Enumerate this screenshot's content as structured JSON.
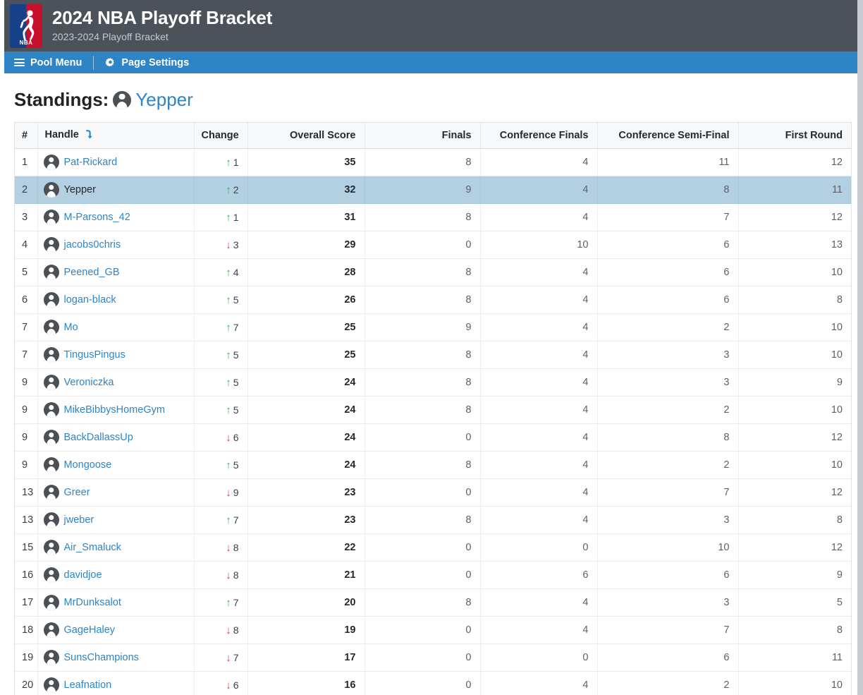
{
  "header": {
    "logo_icon": "nba-logo",
    "logo_word": "NBA",
    "title": "2024 NBA Playoff Bracket",
    "subtitle": "2023-2024 Playoff Bracket",
    "bg_color": "#4b525a"
  },
  "nav": {
    "bg_color": "#2f84c6",
    "items": [
      {
        "label": "Pool Menu",
        "icon": "hamburger-icon"
      },
      {
        "label": "Page Settings",
        "icon": "gear-icon"
      }
    ]
  },
  "standings": {
    "label": "Standings:",
    "user": "Yepper",
    "user_avatar_icon": "avatar-icon",
    "accent_color": "#2f84c6"
  },
  "table": {
    "sort_icon": "sort-descending-arrow-icon",
    "highlight_color": "#b3d0e3",
    "columns": [
      {
        "key": "rank",
        "label": "#"
      },
      {
        "key": "handle",
        "label": "Handle"
      },
      {
        "key": "change",
        "label": "Change"
      },
      {
        "key": "score",
        "label": "Overall Score"
      },
      {
        "key": "finals",
        "label": "Finals"
      },
      {
        "key": "cf",
        "label": "Conference Finals"
      },
      {
        "key": "csf",
        "label": "Conference Semi-Final"
      },
      {
        "key": "fr",
        "label": "First Round"
      }
    ],
    "rows": [
      {
        "rank": "1",
        "handle": "Pat-Rickard",
        "dir": "up",
        "delta": "1",
        "score": "35",
        "finals": "8",
        "cf": "4",
        "csf": "11",
        "fr": "12",
        "me": false
      },
      {
        "rank": "2",
        "handle": "Yepper",
        "dir": "up",
        "delta": "2",
        "score": "32",
        "finals": "9",
        "cf": "4",
        "csf": "8",
        "fr": "11",
        "me": true
      },
      {
        "rank": "3",
        "handle": "M-Parsons_42",
        "dir": "up",
        "delta": "1",
        "score": "31",
        "finals": "8",
        "cf": "4",
        "csf": "7",
        "fr": "12",
        "me": false
      },
      {
        "rank": "4",
        "handle": "jacobs0chris",
        "dir": "down",
        "delta": "3",
        "score": "29",
        "finals": "0",
        "cf": "10",
        "csf": "6",
        "fr": "13",
        "me": false
      },
      {
        "rank": "5",
        "handle": "Peened_GB",
        "dir": "up",
        "delta": "4",
        "score": "28",
        "finals": "8",
        "cf": "4",
        "csf": "6",
        "fr": "10",
        "me": false
      },
      {
        "rank": "6",
        "handle": "logan-black",
        "dir": "up",
        "delta": "5",
        "score": "26",
        "finals": "8",
        "cf": "4",
        "csf": "6",
        "fr": "8",
        "me": false
      },
      {
        "rank": "7",
        "handle": "Mo",
        "dir": "up",
        "delta": "7",
        "score": "25",
        "finals": "9",
        "cf": "4",
        "csf": "2",
        "fr": "10",
        "me": false
      },
      {
        "rank": "7",
        "handle": "TingusPingus",
        "dir": "up",
        "delta": "5",
        "score": "25",
        "finals": "8",
        "cf": "4",
        "csf": "3",
        "fr": "10",
        "me": false
      },
      {
        "rank": "9",
        "handle": "Veroniczka",
        "dir": "up",
        "delta": "5",
        "score": "24",
        "finals": "8",
        "cf": "4",
        "csf": "3",
        "fr": "9",
        "me": false
      },
      {
        "rank": "9",
        "handle": "MikeBibbysHomeGym",
        "dir": "up",
        "delta": "5",
        "score": "24",
        "finals": "8",
        "cf": "4",
        "csf": "2",
        "fr": "10",
        "me": false
      },
      {
        "rank": "9",
        "handle": "BackDallassUp",
        "dir": "down",
        "delta": "6",
        "score": "24",
        "finals": "0",
        "cf": "4",
        "csf": "8",
        "fr": "12",
        "me": false
      },
      {
        "rank": "9",
        "handle": "Mongoose",
        "dir": "up",
        "delta": "5",
        "score": "24",
        "finals": "8",
        "cf": "4",
        "csf": "2",
        "fr": "10",
        "me": false
      },
      {
        "rank": "13",
        "handle": "Greer",
        "dir": "down",
        "delta": "9",
        "score": "23",
        "finals": "0",
        "cf": "4",
        "csf": "7",
        "fr": "12",
        "me": false
      },
      {
        "rank": "13",
        "handle": "jweber",
        "dir": "up",
        "delta": "7",
        "score": "23",
        "finals": "8",
        "cf": "4",
        "csf": "3",
        "fr": "8",
        "me": false
      },
      {
        "rank": "15",
        "handle": "Air_Smaluck",
        "dir": "down",
        "delta": "8",
        "score": "22",
        "finals": "0",
        "cf": "0",
        "csf": "10",
        "fr": "12",
        "me": false
      },
      {
        "rank": "16",
        "handle": "davidjoe",
        "dir": "down",
        "delta": "8",
        "score": "21",
        "finals": "0",
        "cf": "6",
        "csf": "6",
        "fr": "9",
        "me": false
      },
      {
        "rank": "17",
        "handle": "MrDunksalot",
        "dir": "up",
        "delta": "7",
        "score": "20",
        "finals": "8",
        "cf": "4",
        "csf": "3",
        "fr": "5",
        "me": false
      },
      {
        "rank": "18",
        "handle": "GageHaley",
        "dir": "down",
        "delta": "8",
        "score": "19",
        "finals": "0",
        "cf": "4",
        "csf": "7",
        "fr": "8",
        "me": false
      },
      {
        "rank": "19",
        "handle": "SunsChampions",
        "dir": "down",
        "delta": "7",
        "score": "17",
        "finals": "0",
        "cf": "0",
        "csf": "6",
        "fr": "11",
        "me": false
      },
      {
        "rank": "20",
        "handle": "Leafnation",
        "dir": "down",
        "delta": "6",
        "score": "16",
        "finals": "0",
        "cf": "4",
        "csf": "2",
        "fr": "10",
        "me": false
      }
    ]
  }
}
